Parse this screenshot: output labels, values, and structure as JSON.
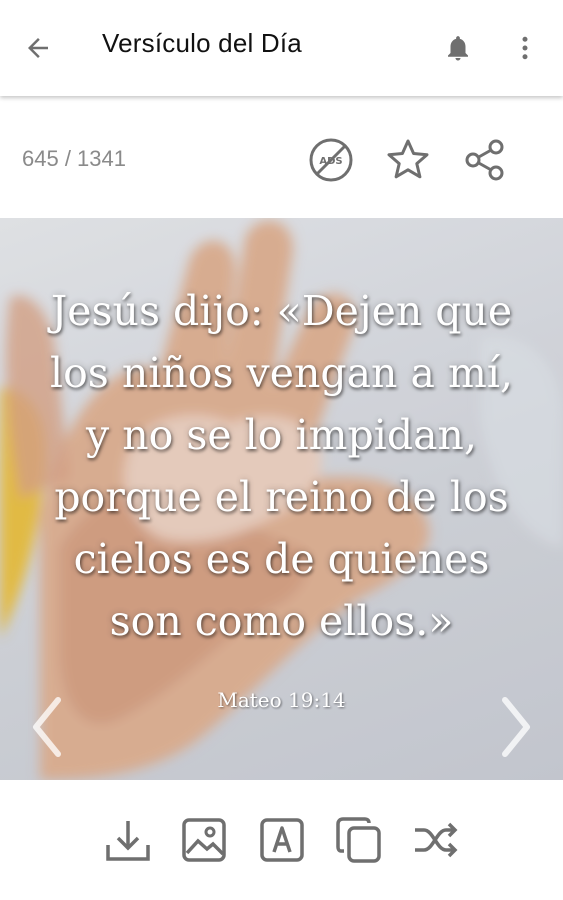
{
  "appbar": {
    "title": "Versículo del Día",
    "icons": {
      "back": "arrow-left-icon",
      "notifications": "bell-icon",
      "menu": "more-vert-icon"
    }
  },
  "verse_nav": {
    "counter": "645 / 1341",
    "actions": [
      "remove-ads-icon",
      "star-icon",
      "share-icon"
    ]
  },
  "verse": {
    "lines": [
      "Jesús dijo: «Dejen que",
      "los niños vengan a mí,",
      "y no se lo impidan,",
      "porque el reino de los",
      "cielos es de quienes",
      "son como ellos.»"
    ],
    "reference": "Mateo 19:14",
    "background": "photo of an adult hand holding a baby's hand"
  },
  "toolbar": {
    "tools": [
      "download-icon",
      "image-icon",
      "text-format-icon",
      "copy-icon",
      "shuffle-icon"
    ]
  },
  "colors": {
    "icon_gray": "#6f6f6f",
    "title_text": "#111111",
    "counter_text": "#8a8a8a"
  }
}
